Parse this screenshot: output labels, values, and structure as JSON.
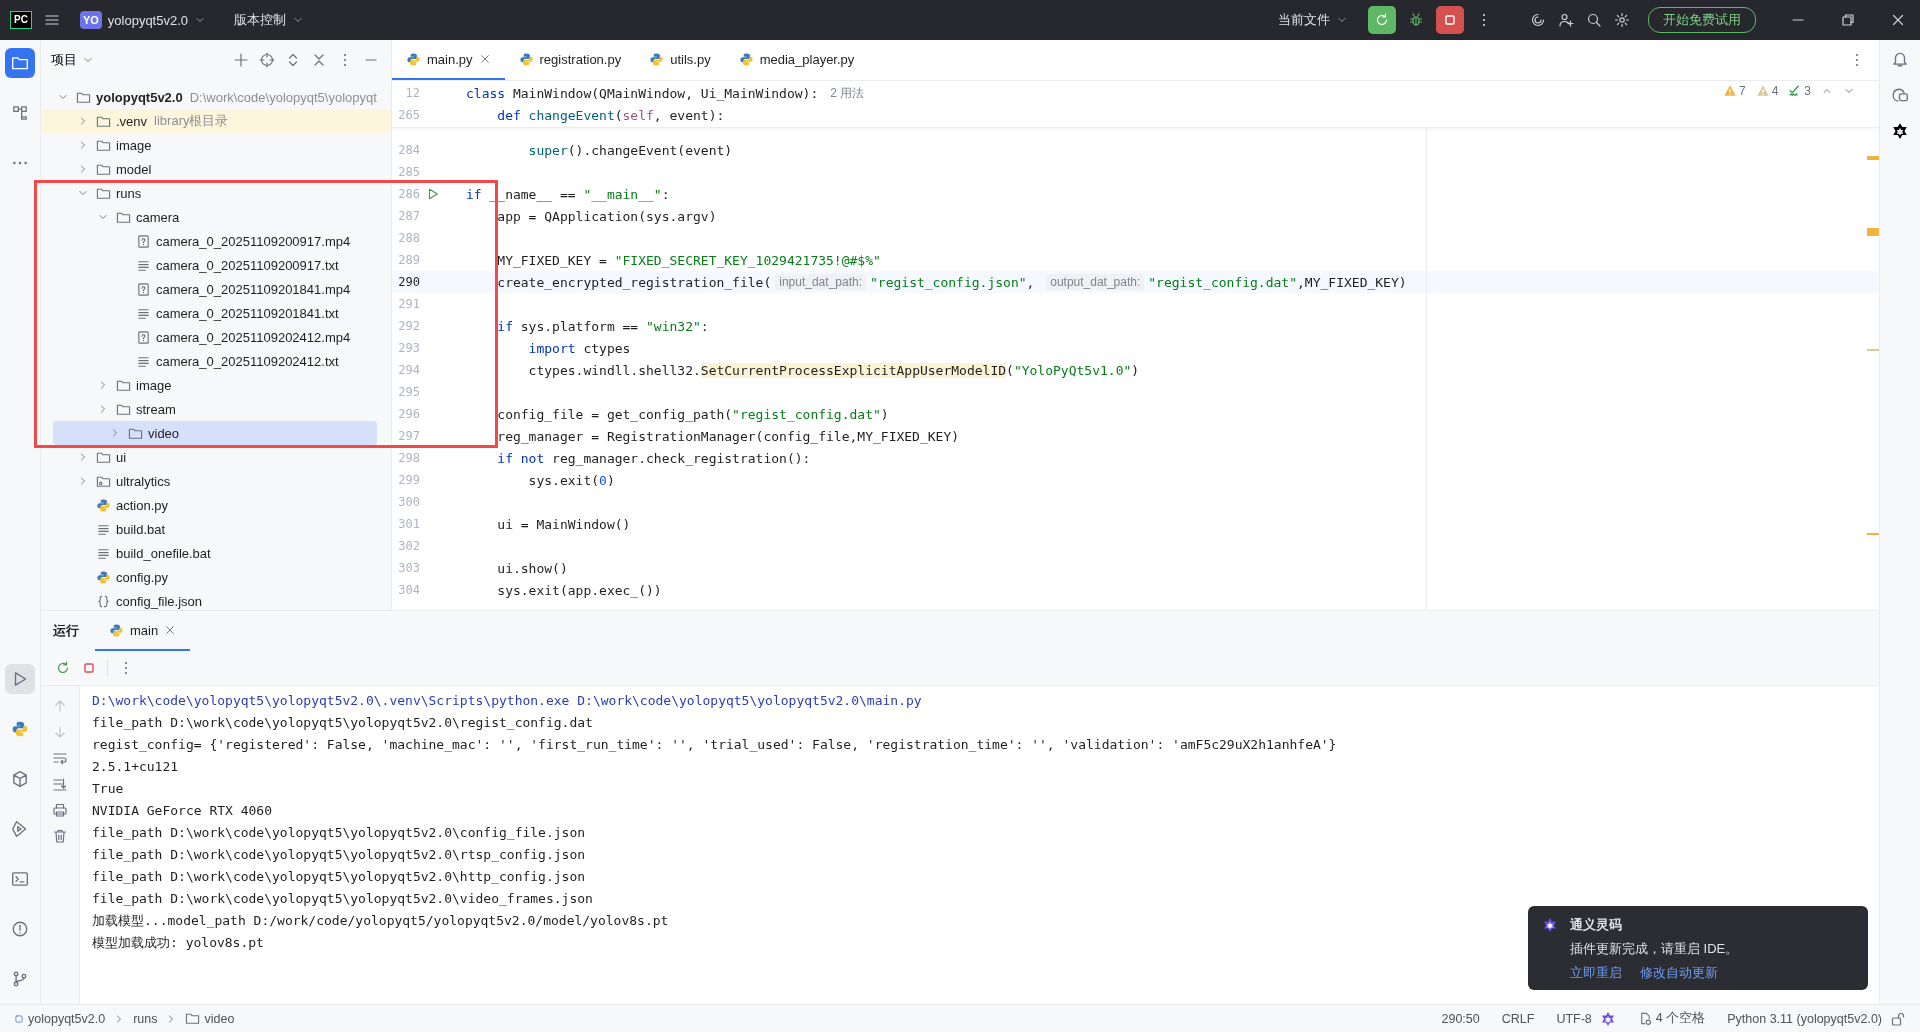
{
  "title_bar": {
    "logo": "PC",
    "project_badge": "YO",
    "project": "yolopyqt5v2.0",
    "vcs": "版本控制",
    "run_config": "当前文件",
    "trial_button": "开始免费试用"
  },
  "left_toolbar": {
    "top": [
      {
        "kind": "project",
        "selected": true
      },
      {
        "kind": "structure",
        "selected": false
      },
      {
        "kind": "more",
        "selected": false
      }
    ],
    "bottom": [
      {
        "kind": "run",
        "selected": true
      },
      {
        "kind": "python",
        "selected": false
      },
      {
        "kind": "packages",
        "selected": false
      },
      {
        "kind": "services",
        "selected": false
      },
      {
        "kind": "terminal",
        "selected": false
      },
      {
        "kind": "problems",
        "selected": false
      },
      {
        "kind": "git",
        "selected": false
      }
    ]
  },
  "project_panel": {
    "title": "项目",
    "tree": [
      {
        "name": "yolopyqt5v2.0",
        "note": "D:\\work\\code\\yolopyqt5\\yolopyqt",
        "kind": "folder",
        "expanded": true,
        "selected": false,
        "library": false,
        "children": [
          {
            "name": ".venv",
            "note": "library根目录",
            "kind": "folder",
            "expanded": false,
            "selected": false,
            "library": true
          },
          {
            "name": "image",
            "kind": "folder",
            "expanded": false,
            "selected": false,
            "library": false
          },
          {
            "name": "model",
            "kind": "folder",
            "expanded": false,
            "selected": false,
            "library": false
          },
          {
            "name": "runs",
            "kind": "folder",
            "expanded": true,
            "selected": false,
            "library": false,
            "children": [
              {
                "name": "camera",
                "kind": "folder",
                "expanded": true,
                "selected": false,
                "library": false,
                "children": [
                  {
                    "name": "camera_0_20251109200917.mp4",
                    "kind": "unknown",
                    "selected": false,
                    "library": false
                  },
                  {
                    "name": "camera_0_20251109200917.txt",
                    "kind": "text",
                    "selected": false,
                    "library": false
                  },
                  {
                    "name": "camera_0_20251109201841.mp4",
                    "kind": "unknown",
                    "selected": false,
                    "library": false
                  },
                  {
                    "name": "camera_0_20251109201841.txt",
                    "kind": "text",
                    "selected": false,
                    "library": false
                  },
                  {
                    "name": "camera_0_20251109202412.mp4",
                    "kind": "unknown",
                    "selected": false,
                    "library": false
                  },
                  {
                    "name": "camera_0_20251109202412.txt",
                    "kind": "text",
                    "selected": false,
                    "library": false
                  }
                ]
              },
              {
                "name": "image",
                "kind": "folder",
                "expanded": false,
                "selected": false,
                "library": false
              },
              {
                "name": "stream",
                "kind": "folder",
                "expanded": false,
                "selected": false,
                "library": false
              },
              {
                "name": "video",
                "kind": "folder",
                "expanded": false,
                "selected": true,
                "library": false
              }
            ]
          },
          {
            "name": "ui",
            "kind": "folder",
            "expanded": false,
            "selected": false,
            "library": false
          },
          {
            "name": "ultralytics",
            "kind": "package",
            "expanded": false,
            "selected": false,
            "library": false
          },
          {
            "name": "action.py",
            "kind": "python",
            "selected": false,
            "library": false
          },
          {
            "name": "build.bat",
            "kind": "text",
            "selected": false,
            "library": false
          },
          {
            "name": "build_onefile.bat",
            "kind": "text",
            "selected": false,
            "library": false
          },
          {
            "name": "config.py",
            "kind": "python",
            "selected": false,
            "library": false
          },
          {
            "name": "config_file.json",
            "kind": "json",
            "selected": false,
            "library": false
          }
        ]
      }
    ]
  },
  "editor": {
    "tabs": [
      {
        "label": "main.py",
        "selected": true,
        "closable": true
      },
      {
        "label": "registration.py",
        "selected": false,
        "closable": false
      },
      {
        "label": "utils.py",
        "selected": false,
        "closable": false
      },
      {
        "label": "media_player.py",
        "selected": false,
        "closable": false
      }
    ],
    "inspections": [
      {
        "kind": "warning",
        "count": "7"
      },
      {
        "kind": "weak",
        "count": "4"
      },
      {
        "kind": "typo",
        "count": "3"
      }
    ],
    "sticky": [
      {
        "number": "12",
        "tokens": [
          {
            "kind": "keyword",
            "text": "class"
          },
          {
            "kind": "plain",
            "text": " MainWindow(QMainWindow, Ui_MainWindow):"
          },
          {
            "kind": "usage",
            "text": "2 用法"
          }
        ]
      },
      {
        "number": "265",
        "tokens": [
          {
            "kind": "keyword",
            "text": "    def"
          },
          {
            "kind": "function",
            "text": " changeEvent"
          },
          {
            "kind": "plain",
            "text": "("
          },
          {
            "kind": "self",
            "text": "self"
          },
          {
            "kind": "plain",
            "text": ", event):"
          }
        ]
      }
    ],
    "lines": [
      {
        "number": "284",
        "current": false,
        "run_marker": false,
        "tokens": [
          {
            "kind": "function",
            "text": "        super"
          },
          {
            "kind": "plain",
            "text": "().changeEvent(event)"
          }
        ]
      },
      {
        "number": "285",
        "current": false,
        "run_marker": false
      },
      {
        "number": "286",
        "current": false,
        "run_marker": true,
        "tokens": [
          {
            "kind": "keyword",
            "text": "if"
          },
          {
            "kind": "plain",
            "text": " __name__ == "
          },
          {
            "kind": "string",
            "text": "\"__main__\""
          },
          {
            "kind": "plain",
            "text": ":"
          }
        ]
      },
      {
        "number": "287",
        "current": false,
        "run_marker": false,
        "tokens": [
          {
            "kind": "plain",
            "text": "    app = QApplication(sys.argv)"
          }
        ]
      },
      {
        "number": "288",
        "current": false,
        "run_marker": false
      },
      {
        "number": "289",
        "current": false,
        "run_marker": false,
        "tokens": [
          {
            "kind": "plain",
            "text": "    MY_FIXED_KEY = "
          },
          {
            "kind": "string",
            "text": "\"FIXED_SECRET_KEY_1029421735!@#$%\""
          }
        ]
      },
      {
        "number": "290",
        "current": true,
        "run_marker": false,
        "tokens": [
          {
            "kind": "plain",
            "text": "    create_encrypted_registration_file("
          },
          {
            "kind": "hint",
            "text": "input_dat_path:"
          },
          {
            "kind": "string",
            "text": "\"regist_config.json\""
          },
          {
            "kind": "plain",
            "text": ", "
          },
          {
            "kind": "hint",
            "text": "output_dat_path:"
          },
          {
            "kind": "string",
            "text": "\"regist_config.dat\""
          },
          {
            "kind": "plain",
            "text": ",MY_FIXED_KEY)"
          }
        ]
      },
      {
        "number": "291",
        "current": false,
        "run_marker": false
      },
      {
        "number": "292",
        "current": false,
        "run_marker": false,
        "tokens": [
          {
            "kind": "keyword",
            "text": "    if"
          },
          {
            "kind": "plain",
            "text": " sys.platform == "
          },
          {
            "kind": "string",
            "text": "\"win32\""
          },
          {
            "kind": "plain",
            "text": ":"
          }
        ]
      },
      {
        "number": "293",
        "current": false,
        "run_marker": false,
        "tokens": [
          {
            "kind": "keyword",
            "text": "        import"
          },
          {
            "kind": "plain",
            "text": " ctypes"
          }
        ]
      },
      {
        "number": "294",
        "current": false,
        "run_marker": false,
        "tokens": [
          {
            "kind": "plain",
            "text": "        ctypes.windll.shell32."
          },
          {
            "kind": "highlight",
            "text": "SetCurrentProcessExplicitAppUserModelID"
          },
          {
            "kind": "plain",
            "text": "("
          },
          {
            "kind": "string",
            "text": "\"YoloPyQt5v1.0\""
          },
          {
            "kind": "plain",
            "text": ")"
          }
        ]
      },
      {
        "number": "295",
        "current": false,
        "run_marker": false
      },
      {
        "number": "296",
        "current": false,
        "run_marker": false,
        "tokens": [
          {
            "kind": "plain",
            "text": "    config_file = get_config_path("
          },
          {
            "kind": "string",
            "text": "\"regist_config.dat\""
          },
          {
            "kind": "plain",
            "text": ")"
          }
        ]
      },
      {
        "number": "297",
        "current": false,
        "run_marker": false,
        "tokens": [
          {
            "kind": "plain",
            "text": "    reg_manager = RegistrationManager(config_file,MY_FIXED_KEY)"
          }
        ]
      },
      {
        "number": "298",
        "current": false,
        "run_marker": false,
        "tokens": [
          {
            "kind": "keyword",
            "text": "    if not"
          },
          {
            "kind": "plain",
            "text": " reg_manager.check_registration():"
          }
        ]
      },
      {
        "number": "299",
        "current": false,
        "run_marker": false,
        "tokens": [
          {
            "kind": "plain",
            "text": "        sys.exit("
          },
          {
            "kind": "number",
            "text": "0"
          },
          {
            "kind": "plain",
            "text": ")"
          }
        ]
      },
      {
        "number": "300",
        "current": false,
        "run_marker": false
      },
      {
        "number": "301",
        "current": false,
        "run_marker": false,
        "tokens": [
          {
            "kind": "plain",
            "text": "    ui = MainWindow()"
          }
        ]
      },
      {
        "number": "302",
        "current": false,
        "run_marker": false
      },
      {
        "number": "303",
        "current": false,
        "run_marker": false,
        "tokens": [
          {
            "kind": "plain",
            "text": "    ui.show()"
          }
        ]
      },
      {
        "number": "304",
        "current": false,
        "run_marker": false,
        "tokens": [
          {
            "kind": "plain",
            "text": "    sys.exit(app.exec_())"
          }
        ]
      }
    ]
  },
  "run_panel": {
    "title": "运行",
    "tabs": [
      {
        "label": "main",
        "selected": true
      }
    ],
    "console": [
      {
        "kind": "command",
        "text": "D:\\work\\code\\yolopyqt5\\yolopyqt5v2.0\\.venv\\Scripts\\python.exe D:\\work\\code\\yolopyqt5\\yolopyqt5v2.0\\main.py"
      },
      {
        "kind": "output",
        "text": "file_path D:\\work\\code\\yolopyqt5\\yolopyqt5v2.0\\regist_config.dat"
      },
      {
        "kind": "output",
        "text": "regist_config= {'registered': False, 'machine_mac': '', 'first_run_time': '', 'trial_used': False, 'registration_time': '', 'validation': 'amF5c29uX2h1anhfeA'}"
      },
      {
        "kind": "output",
        "text": "2.5.1+cu121"
      },
      {
        "kind": "output",
        "text": "True"
      },
      {
        "kind": "output",
        "text": "NVIDIA GeForce RTX 4060"
      },
      {
        "kind": "output",
        "text": "file_path D:\\work\\code\\yolopyqt5\\yolopyqt5v2.0\\config_file.json"
      },
      {
        "kind": "output",
        "text": "file_path D:\\work\\code\\yolopyqt5\\yolopyqt5v2.0\\rtsp_config.json"
      },
      {
        "kind": "output",
        "text": "file_path D:\\work\\code\\yolopyqt5\\yolopyqt5v2.0\\http_config.json"
      },
      {
        "kind": "output",
        "text": "file_path D:\\work\\code\\yolopyqt5\\yolopyqt5v2.0\\video_frames.json"
      },
      {
        "kind": "output",
        "text": "加载模型...model_path D:/work/code/yolopyqt5/yolopyqt5v2.0/model/yolov8s.pt"
      },
      {
        "kind": "output",
        "text": "模型加载成功: yolov8s.pt"
      }
    ]
  },
  "notification": {
    "title": "通义灵码",
    "message": "插件更新完成，请重启 IDE。",
    "actions": [
      "立即重启",
      "修改自动更新"
    ]
  },
  "status_bar": {
    "breadcrumbs": [
      {
        "label": "yolopyqt5v2.0",
        "kind": "module"
      },
      {
        "label": "runs",
        "kind": "plain"
      },
      {
        "label": "video",
        "kind": "folder"
      }
    ],
    "position": "290:50",
    "line_separator": "CRLF",
    "encoding": "UTF-8",
    "indent": "4 个空格",
    "interpreter": "Python 3.11 (yolopyqt5v2.0)"
  }
}
